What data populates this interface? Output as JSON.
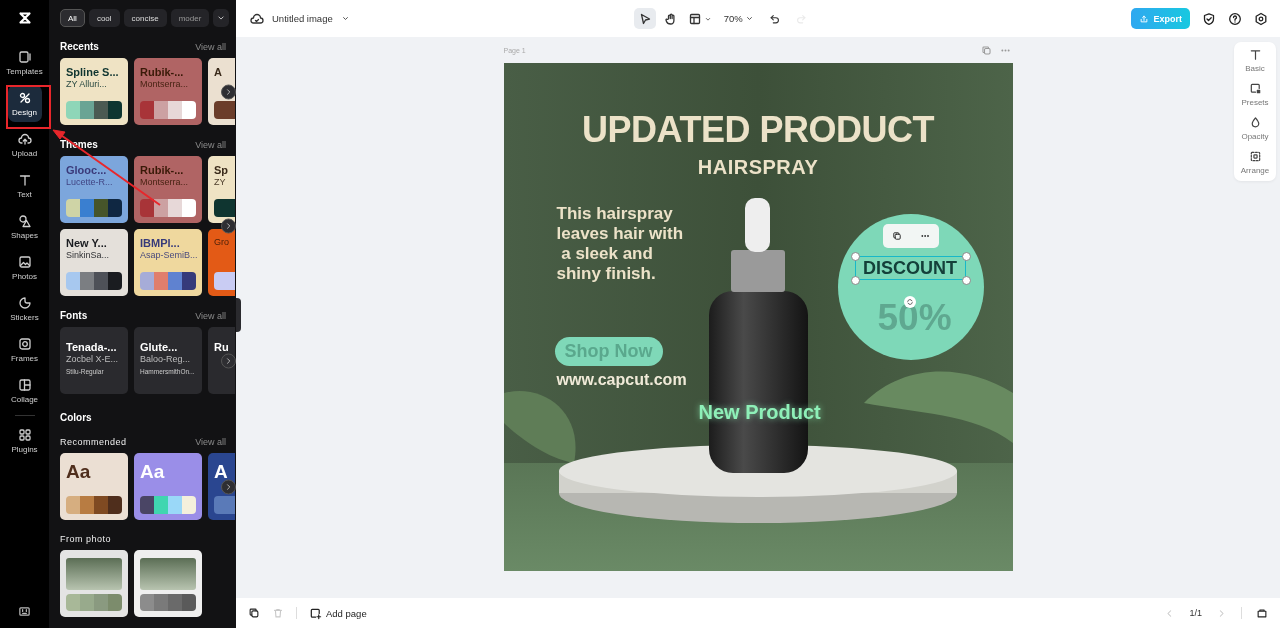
{
  "rail": {
    "items": [
      {
        "label": "Templates",
        "selected": false
      },
      {
        "label": "Design",
        "selected": true
      },
      {
        "label": "Upload",
        "selected": false
      },
      {
        "label": "Text",
        "selected": false
      },
      {
        "label": "Shapes",
        "selected": false
      },
      {
        "label": "Photos",
        "selected": false
      },
      {
        "label": "Stickers",
        "selected": false
      },
      {
        "label": "Frames",
        "selected": false
      },
      {
        "label": "Collage",
        "selected": false
      }
    ],
    "extra_items": [
      {
        "label": "Plugins",
        "selected": false
      }
    ]
  },
  "panel": {
    "filters": [
      {
        "label": "All",
        "selected": true
      },
      {
        "label": "cool",
        "selected": false
      },
      {
        "label": "concise",
        "selected": false
      },
      {
        "label": "moder",
        "selected": false
      }
    ],
    "sections": [
      {
        "kind": "heading",
        "title": "Recents",
        "link": "View all",
        "scroll_button": true,
        "rows": [
          [
            {
              "kind": "theme",
              "title": "Spline S...",
              "subtitle": "ZY Alluri...",
              "color": "#efe3c4",
              "swatches": [
                {
                  "color": "#8ed6b8"
                },
                {
                  "color": "#6aa494"
                },
                {
                  "color": "#4b5a52"
                },
                {
                  "color": "#0f3530"
                }
              ]
            },
            {
              "kind": "theme",
              "title": "Rubik-...",
              "subtitle": "Montserra...",
              "color": "#b06464",
              "swatches": [
                {
                  "color": "#a83438"
                },
                {
                  "color": "#cca1a2"
                },
                {
                  "color": "#e7d8d8"
                },
                {
                  "color": "#ffffff"
                }
              ]
            },
            {
              "kind": "theme",
              "title": "A",
              "color": "#ebe0d0",
              "swatches": [
                {
                  "color": "#6b3d2a"
                }
              ]
            }
          ]
        ]
      },
      {
        "kind": "heading",
        "title": "Themes",
        "link": "View all",
        "scroll_button": true,
        "rows": [
          [
            {
              "kind": "theme",
              "title": "Glooc...",
              "subtitle": "Lucette-R...",
              "color": "#7ca6dc",
              "swatches": [
                {
                  "color": "#cfd4a6"
                },
                {
                  "color": "#3a7fd0"
                },
                {
                  "color": "#46552a"
                },
                {
                  "color": "#0f2742"
                }
              ]
            },
            {
              "kind": "theme",
              "title": "Rubik-...",
              "subtitle": "Montserra...",
              "color": "#b06464",
              "swatches": [
                {
                  "color": "#a83438"
                },
                {
                  "color": "#cca1a2"
                },
                {
                  "color": "#e7d8d8"
                },
                {
                  "color": "#ffffff"
                }
              ]
            },
            {
              "kind": "theme",
              "title": "Sp",
              "subtitle": "ZY",
              "color": "#efe3c4",
              "swatches": [
                {
                  "color": "#0f3530"
                }
              ]
            }
          ],
          [
            {
              "kind": "theme",
              "title": "New Y...",
              "subtitle": "SinkinSa...",
              "color": "#e4e0da",
              "swatches": [
                {
                  "color": "#a7c8ef"
                },
                {
                  "color": "#7b7e82"
                },
                {
                  "color": "#4e5158"
                },
                {
                  "color": "#1a1c20"
                }
              ]
            },
            {
              "kind": "theme",
              "title": "IBMPl...",
              "subtitle": "Asap-SemiB...",
              "color": "#efd89e",
              "swatches": [
                {
                  "color": "#a6acd8"
                },
                {
                  "color": "#e07e6c"
                },
                {
                  "color": "#5f82d0"
                },
                {
                  "color": "#363a7a"
                }
              ]
            },
            {
              "kind": "theme",
              "subtitle": "Gro",
              "color": "#e35a16",
              "swatches": [
                {
                  "color": "#c9ccf3"
                }
              ]
            }
          ]
        ]
      },
      {
        "kind": "heading",
        "title": "Fonts",
        "link": "View all",
        "scroll_button": true,
        "rows": [
          [
            {
              "kind": "font",
              "title": "Tenada-...",
              "subtitle": "Zocbel X-E...",
              "caption": "Stilu-Regular"
            },
            {
              "kind": "font",
              "title": "Glute...",
              "subtitle": "Baloo-Reg...",
              "caption": "HammersmithOn..."
            },
            {
              "kind": "font",
              "title": "Ru"
            }
          ]
        ]
      },
      {
        "kind": "group",
        "title": "Colors"
      },
      {
        "kind": "subheading",
        "title": "Recommended",
        "link": "View all",
        "scroll_button": true,
        "rows": [
          [
            {
              "kind": "color",
              "title": "Aa",
              "color": "#ebdfd3",
              "swatches": [
                {
                  "color": "#d6ae80"
                },
                {
                  "color": "#b87c42"
                },
                {
                  "color": "#7f4a22"
                },
                {
                  "color": "#4f2e1c"
                }
              ]
            },
            {
              "kind": "color",
              "title": "Aa",
              "color": "#9a8ee8",
              "swatches": [
                {
                  "color": "#4a4565"
                },
                {
                  "color": "#40d6b0"
                },
                {
                  "color": "#9ad8f8"
                },
                {
                  "color": "#f4f0dc"
                }
              ]
            },
            {
              "kind": "color",
              "title": "A",
              "color": "#2a4690",
              "swatches": [
                {
                  "color": "#5a7ab8"
                }
              ]
            }
          ]
        ]
      },
      {
        "kind": "subheading",
        "title": "From photo",
        "rows": [
          [
            {
              "kind": "photo",
              "color": "#e4e4e4",
              "swatches": [
                {
                  "color": "#a8b898"
                },
                {
                  "color": "#98aa8c"
                },
                {
                  "color": "#8a9a80"
                },
                {
                  "color": "#7c8c6c"
                }
              ]
            },
            {
              "kind": "photo",
              "color": "#efefef",
              "swatches": [
                {
                  "color": "#8c8c8c"
                },
                {
                  "color": "#7a7a7a"
                },
                {
                  "color": "#6a6a6a"
                },
                {
                  "color": "#5a5a5a"
                }
              ]
            }
          ]
        ]
      }
    ]
  },
  "topbar": {
    "title": "Untitled image",
    "tools": [
      {
        "selected": true
      },
      {
        "selected": false
      },
      {
        "selected": false
      }
    ],
    "zoom": "70%",
    "history": [
      {
        "disabled": false
      },
      {
        "disabled": true
      }
    ],
    "export": "Export"
  },
  "canvas": {
    "page_label": "Page 1",
    "design": {
      "headline": "UPDATED PRODUCT",
      "subheadline": "HAIRSPRAY",
      "body": "This hairspray\nleaves hair with\n a sleek and\nshiny finish.",
      "cta": "Shop Now",
      "url": "www.capcut.com",
      "tag": "New Product",
      "badge": {
        "label": "DISCOUNT",
        "value": "50%",
        "selected": true
      }
    },
    "properties": [
      {
        "label": "Basic"
      },
      {
        "label": "Presets"
      },
      {
        "label": "Opacity"
      },
      {
        "label": "Arrange"
      }
    ]
  },
  "bottombar": {
    "delete_disabled": true,
    "add_page": "Add page",
    "prev_disabled": true,
    "pager": "1/1",
    "next_disabled": true
  }
}
